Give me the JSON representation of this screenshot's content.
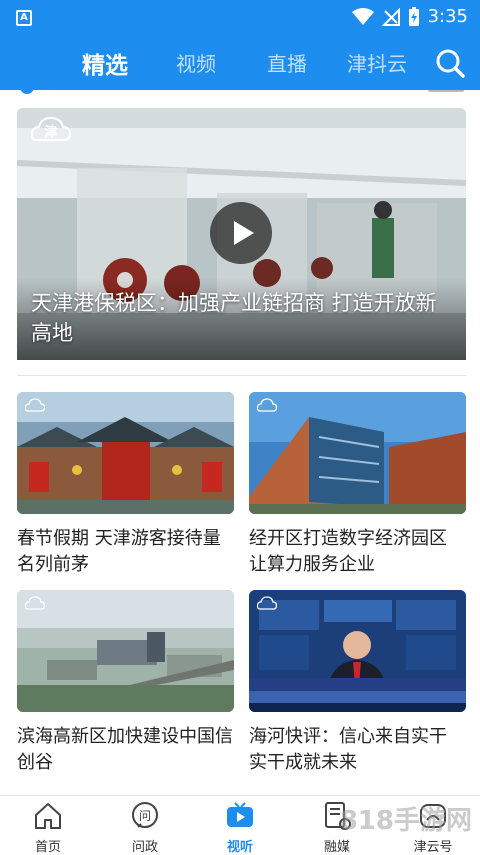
{
  "status_bar": {
    "time": "3:35",
    "app_letter": "A"
  },
  "tabs": [
    {
      "label": "精选",
      "active": true
    },
    {
      "label": "视频",
      "active": false
    },
    {
      "label": "直播",
      "active": false
    },
    {
      "label": "津抖云",
      "active": false
    }
  ],
  "hero": {
    "title": "天津港保税区：加强产业链招商 打造开放新高地",
    "logo_text": "津"
  },
  "cards": [
    {
      "title": "春节假期 天津游客接待量名列前茅"
    },
    {
      "title": "经开区打造数字经济园区 让算力服务企业"
    },
    {
      "title": "滨海高新区加快建设中国信创谷"
    },
    {
      "title": "海河快评：信心来自实干 实干成就未来"
    }
  ],
  "bottom_nav": [
    {
      "label": "首页",
      "icon": "home-icon",
      "active": false
    },
    {
      "label": "问政",
      "icon": "ask-icon",
      "active": false
    },
    {
      "label": "视听",
      "icon": "tv-icon",
      "active": true
    },
    {
      "label": "融媒",
      "icon": "media-icon",
      "active": false
    },
    {
      "label": "津云号",
      "icon": "cloud-account-icon",
      "active": false
    }
  ],
  "watermark": "818手游网",
  "colors": {
    "brand": "#1e8df0",
    "text": "#222222"
  }
}
